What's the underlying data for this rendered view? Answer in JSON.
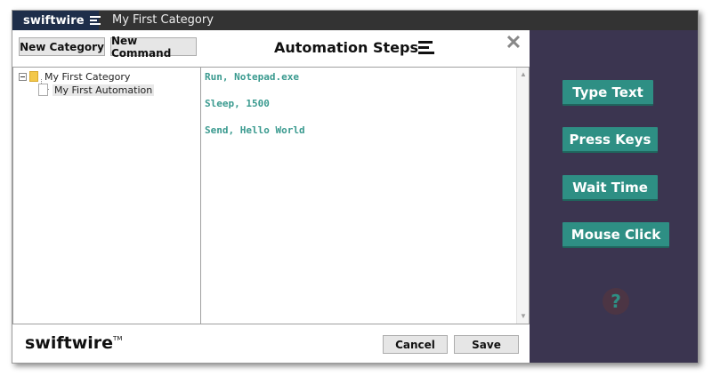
{
  "app": {
    "brand": "swiftwire",
    "current_category": "My First Category"
  },
  "toolbar": {
    "new_category_label": "New Category",
    "new_command_label": "New Command",
    "steps_title": "Automation Steps",
    "close_glyph": "✕"
  },
  "tree": {
    "root_label": "My First Category",
    "child_label": "My First Automation"
  },
  "steps": [
    "Run, Notepad.exe",
    "Sleep, 1500",
    "Send, Hello World"
  ],
  "footer": {
    "logo": "swiftwire",
    "trademark": "TM",
    "cancel_label": "Cancel",
    "save_label": "Save"
  },
  "actions": {
    "type_text": "Type Text",
    "press_keys": "Press Keys",
    "wait_time": "Wait Time",
    "mouse_click": "Mouse Click",
    "help": "?"
  },
  "colors": {
    "accent": "#2e8f84",
    "side_panel": "#3b3550",
    "title_bar": "#333333",
    "step_text": "#3a9a8f"
  },
  "icons": [
    "menu-icon",
    "close-icon",
    "folder-icon",
    "document-icon",
    "help-icon"
  ]
}
